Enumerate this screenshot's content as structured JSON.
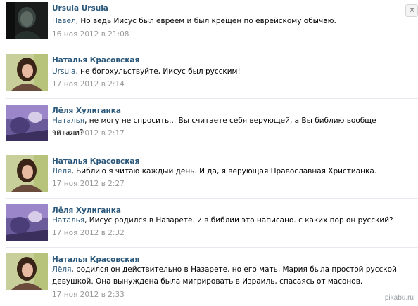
{
  "comments": [
    {
      "author": "Ursula Ursula",
      "mention": "Павел",
      "text": ", Но ведь Иисус был евреем и был крещен по еврейскому обычаю.",
      "date": "16 ноя 2012 в 21:08",
      "avatar": "dark-portrait",
      "delete_icon": "✕"
    },
    {
      "author": "Наталья Красовская",
      "mention": "Ursula",
      "text": ", не богохульствуйте, Иисус был русским!",
      "date": "17 ноя 2012 в 2:14",
      "avatar": "woman-portrait"
    },
    {
      "author": "Лёля Хулиганка",
      "mention": "Наталья",
      "text": ", не могу не спросить... Вы считаете себя верующей, а Вы библию вообще читали?",
      "date": "17 ноя 2012 в 2:17",
      "avatar": "purple-abstract"
    },
    {
      "author": "Наталья Красовская",
      "mention": "Лёля",
      "text": ", Библию я читаю каждый день. И да, я верующая Православная Христианка.",
      "date": "17 ноя 2012 в 2:27",
      "avatar": "woman-portrait"
    },
    {
      "author": "Лёля Хулиганка",
      "mention": "Наталья",
      "text": ", Иисус родился в Назарете. и в библии это написано. с каких пор он русский?",
      "date": "17 ноя 2012 в 2:32",
      "avatar": "purple-abstract"
    },
    {
      "author": "Наталья Красовская",
      "mention": "Лёля",
      "text": ", родился он действительно в Назарете, но его мать, Мария была простой русской девушкой. Она вынуждена была мигрировать в Израиль, спасаясь от масонов.",
      "date": "17 ноя 2012 в 2:33",
      "avatar": "woman-portrait"
    }
  ],
  "watermark": "pikabu.ru",
  "colors": {
    "author": "#2b587a",
    "date": "#999999",
    "separator": "#e6e9ee"
  }
}
